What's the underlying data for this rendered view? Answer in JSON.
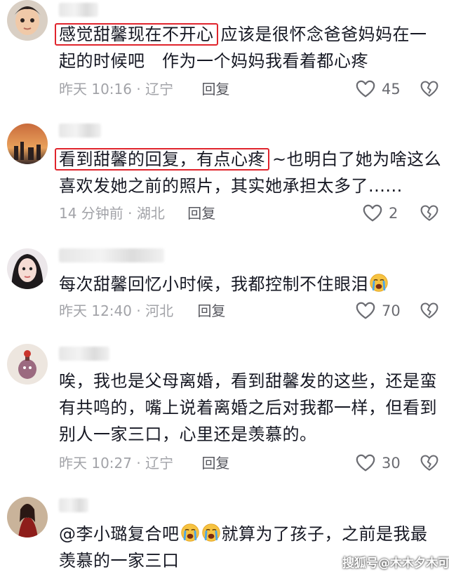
{
  "comments": [
    {
      "highlight": "感觉甜馨现在不开心",
      "line1_rest": "应该是很怀念爸爸妈妈在一",
      "line2": "起的时候吧　作为一个妈妈我看着都心疼",
      "time": "昨天 10:16",
      "location": "辽宁",
      "reply": "回复",
      "likes": "45"
    },
    {
      "highlight": "看到甜馨的回复，有点心疼",
      "line1_rest": "~也明白了她为啥这么",
      "line2": "喜欢发她之前的照片，其实她承担太多了......",
      "time": "14 分钟前",
      "location": "湖北",
      "reply": "回复",
      "likes": "2"
    },
    {
      "line1": "每次甜馨回忆小时候，我都控制不住眼泪",
      "time": "昨天 12:40",
      "location": "河北",
      "reply": "回复",
      "likes": "70"
    },
    {
      "line1": "唉，我也是父母离婚，看到甜馨发的这些，还是蛮",
      "line2": "有共鸣的，嘴上说着离婚之后对我都一样，但看到",
      "line3": "别人一家三口，心里还是羡慕的。",
      "time": "昨天 10:27",
      "location": "辽宁",
      "reply": "回复",
      "likes": "30"
    },
    {
      "line1_a": "@李小璐复合吧",
      "line1_b": "就算为了孩子，之前是我最",
      "line2": "羡慕的一家三口"
    }
  ],
  "meta_separator": "·",
  "watermark": "搜狐号@木木夕木可",
  "icons": {
    "like": "heart-outline-icon",
    "dislike": "broken-heart-icon",
    "emoji": "crying-face-emoji"
  },
  "colors": {
    "highlight_border": "#e0242c",
    "meta_text": "#a2a3a8",
    "main_text": "#161823"
  }
}
